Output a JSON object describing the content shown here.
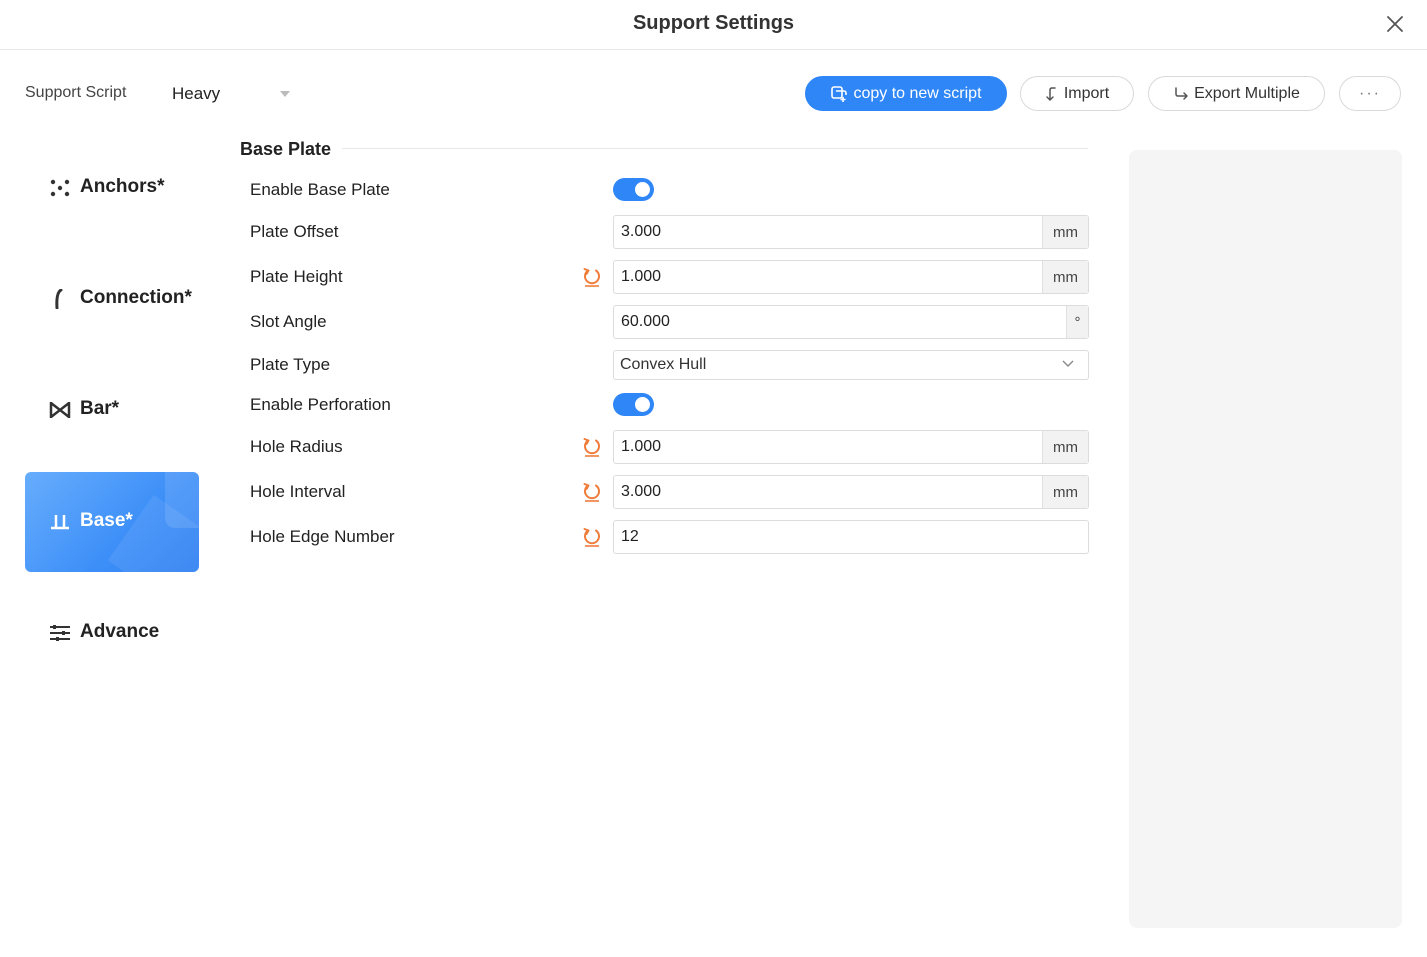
{
  "window": {
    "title": "Support Settings"
  },
  "toolbar": {
    "script_label": "Support Script",
    "script_value": "Heavy",
    "copy_label": "copy to new script",
    "import_label": "Import",
    "export_label": "Export Multiple",
    "more_label": "···"
  },
  "nav": {
    "anchors": "Anchors*",
    "connection": "Connection*",
    "bar": "Bar*",
    "base": "Base*",
    "advance": "Advance",
    "active": "base"
  },
  "section": {
    "title": "Base Plate"
  },
  "fields": {
    "enable_base_plate": {
      "label": "Enable Base Plate",
      "on": true
    },
    "plate_offset": {
      "label": "Plate Offset",
      "value": "3.000",
      "unit": "mm"
    },
    "plate_height": {
      "label": "Plate Height",
      "value": "1.000",
      "unit": "mm"
    },
    "slot_angle": {
      "label": "Slot Angle",
      "value": "60.000",
      "unit": "°"
    },
    "plate_type": {
      "label": "Plate Type",
      "value": "Convex Hull"
    },
    "enable_perforation": {
      "label": "Enable Perforation",
      "on": true
    },
    "hole_radius": {
      "label": "Hole Radius",
      "value": "1.000",
      "unit": "mm"
    },
    "hole_interval": {
      "label": "Hole Interval",
      "value": "3.000",
      "unit": "mm"
    },
    "hole_edge_number": {
      "label": "Hole Edge Number",
      "value": "12"
    }
  },
  "colors": {
    "accent": "#2f86f6",
    "reset_icon": "#f07c3a",
    "preview_bg": "#f5f5f5"
  }
}
